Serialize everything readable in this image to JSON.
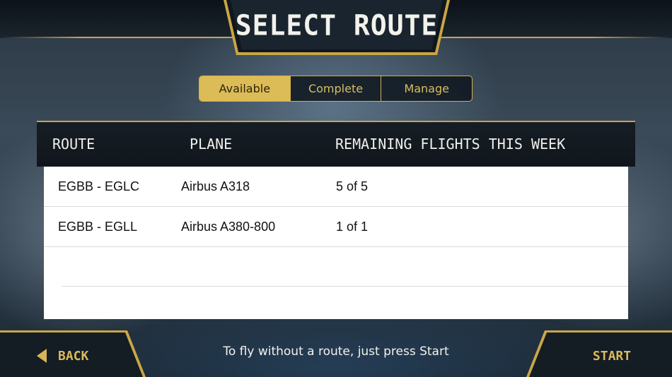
{
  "header": {
    "title": "SELECT ROUTE"
  },
  "tabs": [
    {
      "label": "Available",
      "active": true
    },
    {
      "label": "Complete",
      "active": false
    },
    {
      "label": "Manage",
      "active": false
    }
  ],
  "table": {
    "columns": [
      "ROUTE",
      "PLANE",
      "REMAINING FLIGHTS THIS WEEK"
    ],
    "rows": [
      {
        "route": "EGBB - EGLC",
        "plane": "Airbus A318",
        "remaining": "5 of 5"
      },
      {
        "route": "EGBB - EGLL",
        "plane": "Airbus A380-800",
        "remaining": "1 of 1"
      }
    ]
  },
  "footer": {
    "back_label": "BACK",
    "hint": "To fly without a route, just press Start",
    "start_label": "START"
  },
  "colors": {
    "accent_gold": "#dcbc56",
    "panel_dark": "#10161c",
    "table_bg": "#ffffff"
  },
  "icons": {
    "back": "back-arrow-icon"
  }
}
